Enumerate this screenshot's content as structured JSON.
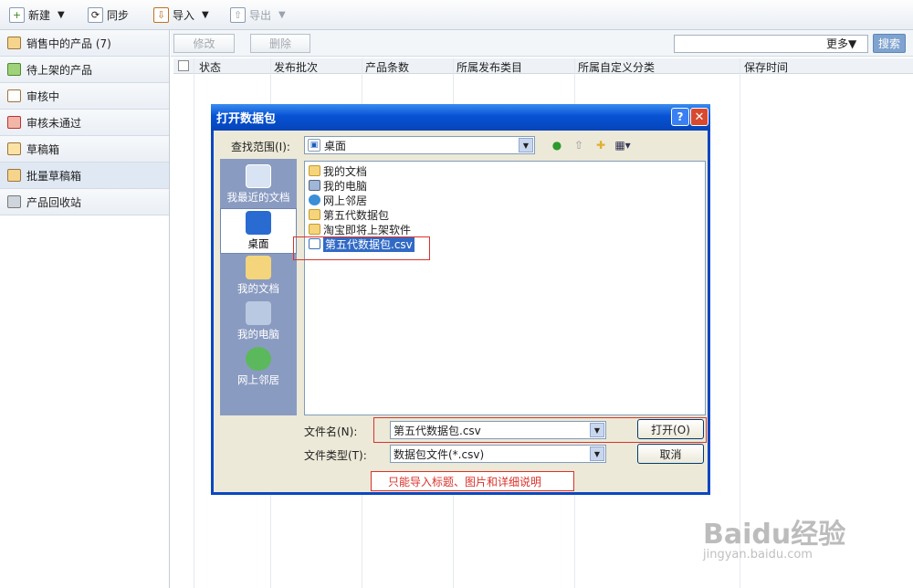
{
  "toolbar": {
    "new": "新建",
    "sync": "同步",
    "import": "导入",
    "export": "导出"
  },
  "sidebar": {
    "items": [
      {
        "label": "销售中的产品 (7)"
      },
      {
        "label": "待上架的产品"
      },
      {
        "label": "审核中"
      },
      {
        "label": "审核未通过"
      },
      {
        "label": "草稿箱"
      },
      {
        "label": "批量草稿箱"
      },
      {
        "label": "产品回收站"
      }
    ]
  },
  "actions": {
    "edit": "修改",
    "delete": "删除",
    "more": "更多▼",
    "search": "搜索",
    "search_value": ""
  },
  "table": {
    "columns": [
      "状态",
      "发布批次",
      "产品条数",
      "所属发布类目",
      "所属自定义分类",
      "保存时间"
    ]
  },
  "dialog": {
    "title": "打开数据包",
    "help": "?",
    "close": "✕",
    "look_in_label": "查找范围(I):",
    "look_in_value": "桌面",
    "places": [
      "我最近的文档",
      "桌面",
      "我的文档",
      "我的电脑",
      "网上邻居"
    ],
    "files": [
      "我的文档",
      "我的电脑",
      "网上邻居",
      "第五代数据包",
      "淘宝即将上架软件",
      "第五代数据包.csv"
    ],
    "filename_label": "文件名(N):",
    "filename_value": "第五代数据包.csv",
    "filetype_label": "文件类型(T):",
    "filetype_value": "数据包文件(*.csv)",
    "open_button": "打开(O)",
    "cancel_button": "取消"
  },
  "annotation_note": "只能导入标题、图片和详细说明",
  "watermark": {
    "text": "Baidu经验",
    "url": "jingyan.baidu.com"
  },
  "colors": {
    "title_bar": "#0752d4",
    "accent_red": "#d9332b",
    "selection": "#316ac5"
  }
}
